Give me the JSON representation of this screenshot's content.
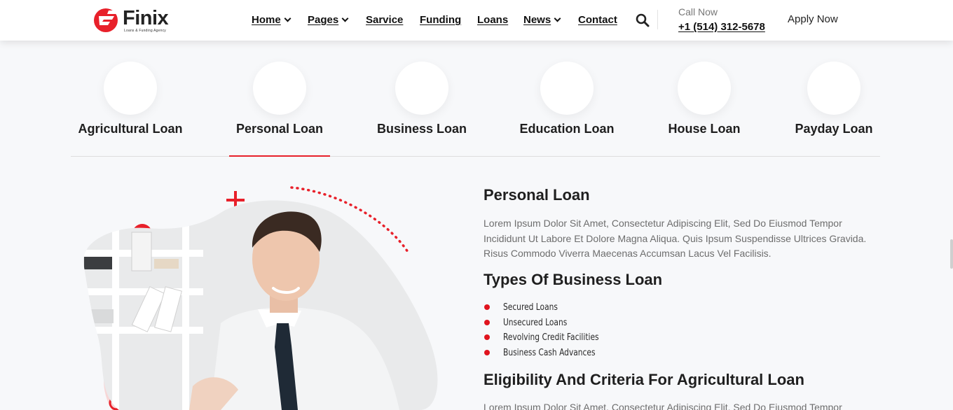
{
  "brand": {
    "name": "Finix",
    "tagline": "Loans & Funding Agency",
    "accent": "#e8202a"
  },
  "nav": {
    "items": [
      {
        "label": "Home",
        "dropdown": true
      },
      {
        "label": "Pages",
        "dropdown": true
      },
      {
        "label": "Sarvice",
        "dropdown": false
      },
      {
        "label": "Funding",
        "dropdown": false
      },
      {
        "label": "Loans",
        "dropdown": false
      },
      {
        "label": "News",
        "dropdown": true
      },
      {
        "label": "Contact",
        "dropdown": false
      }
    ],
    "search_icon": "search-icon",
    "call_label": "Call Now",
    "call_number": "+1 (514) 312-5678",
    "apply_label": "Apply Now"
  },
  "tabs": {
    "items": [
      {
        "label": "Agricultural Loan"
      },
      {
        "label": "Personal Loan"
      },
      {
        "label": "Business Loan"
      },
      {
        "label": "Education Loan"
      },
      {
        "label": "House Loan"
      },
      {
        "label": "Payday Loan"
      }
    ],
    "active_label": "Personal Loan"
  },
  "content": {
    "title": "Personal Loan",
    "intro": "Lorem Ipsum Dolor Sit Amet, Consectetur Adipiscing Elit, Sed Do Eiusmod Tempor Incididunt Ut Labore Et Dolore Magna Aliqua. Quis Ipsum Suspendisse Ultrices Gravida. Risus Commodo Viverra Maecenas Accumsan Lacus Vel Facilisis.",
    "types_title": "Types Of Business Loan",
    "types": [
      "Secured Loans",
      "Unsecured Loans",
      "Revolving Credit Facilities",
      "Business Cash Advances"
    ],
    "eligibility_title": "Eligibility And Criteria For Agricultural Loan",
    "eligibility_text": "Lorem Ipsum Dolor Sit Amet, Consectetur Adipiscing Elit, Sed Do Eiusmod Tempor"
  }
}
